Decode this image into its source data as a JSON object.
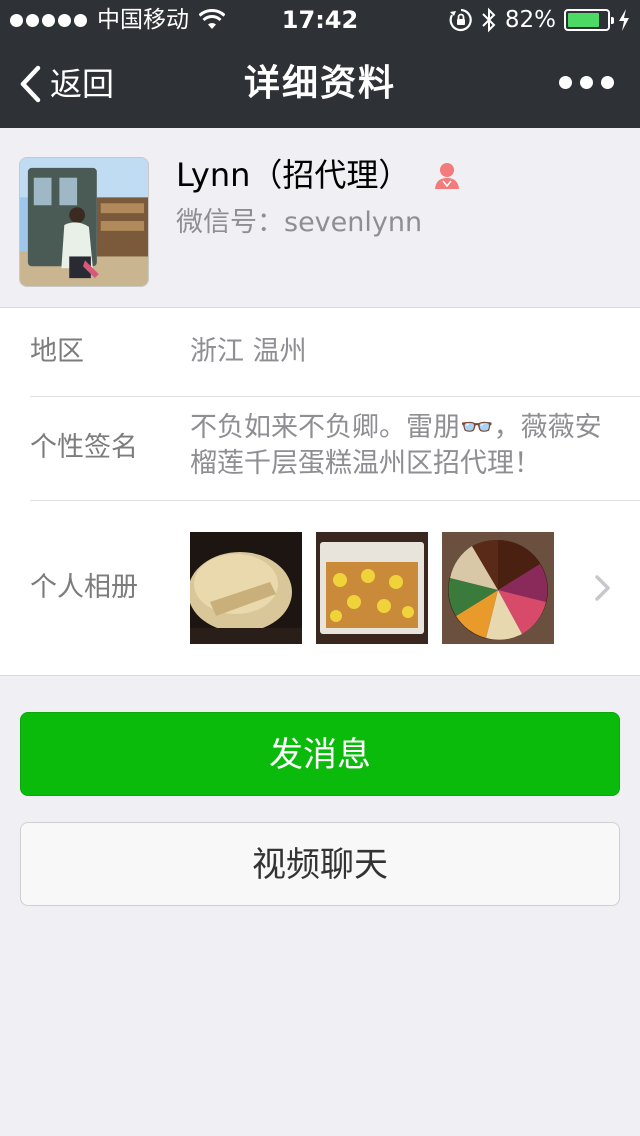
{
  "status_bar": {
    "carrier": "中国移动",
    "time": "17:42",
    "battery_percent": "82%",
    "battery_level": 0.82,
    "battery_color": "#4cd964"
  },
  "nav": {
    "back_label": "返回",
    "title": "详细资料",
    "more_icon": "more-dots-icon"
  },
  "profile": {
    "name": "Lynn（招代理）",
    "wechat_id": "微信号：sevenlynn",
    "gender_icon": "female-icon",
    "gender_color": "#f37b7b"
  },
  "info": {
    "region_label": "地区",
    "region_value": "浙江 温州",
    "signature_label": "个性签名",
    "signature_value": "不负如来不负卿。雷朋👓，薇薇安榴莲千层蛋糕温州区招代理！",
    "album_label": "个人相册",
    "album_thumbs": [
      "crepe-cake-photo",
      "durian-cake-box-photo",
      "rainbow-cake-photo"
    ]
  },
  "actions": {
    "send_message": "发消息",
    "video_chat": "视频聊天",
    "accent_color": "#0bbb0b"
  }
}
